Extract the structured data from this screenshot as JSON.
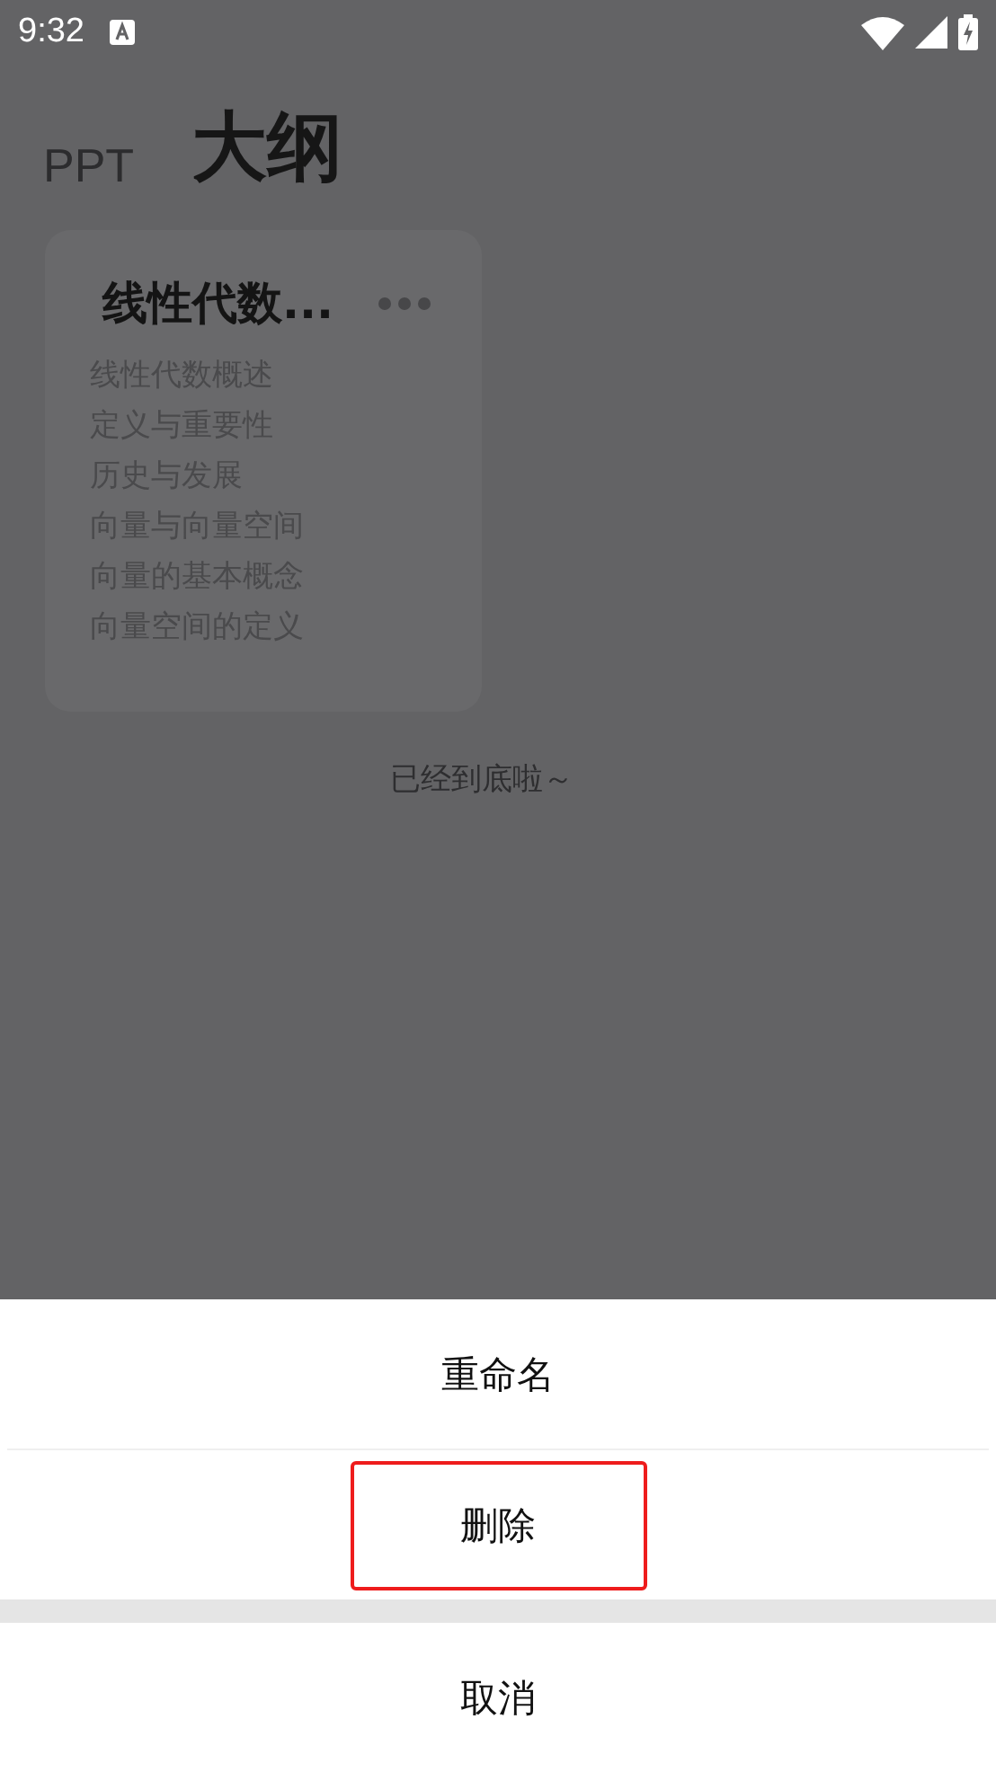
{
  "status_bar": {
    "time": "9:32"
  },
  "tabs": [
    {
      "label": "PPT",
      "selected": false
    },
    {
      "label": "大纲",
      "selected": true
    }
  ],
  "outline_card": {
    "title": "线性代数...",
    "items": [
      "线性代数概述",
      "定义与重要性",
      "历史与发展",
      "向量与向量空间",
      "向量的基本概念",
      "向量空间的定义"
    ]
  },
  "end_notice": "已经到底啦～",
  "action_sheet": {
    "actions": [
      {
        "label": "重命名",
        "highlighted": false
      },
      {
        "label": "删除",
        "highlighted": true
      }
    ],
    "cancel": "取消"
  }
}
